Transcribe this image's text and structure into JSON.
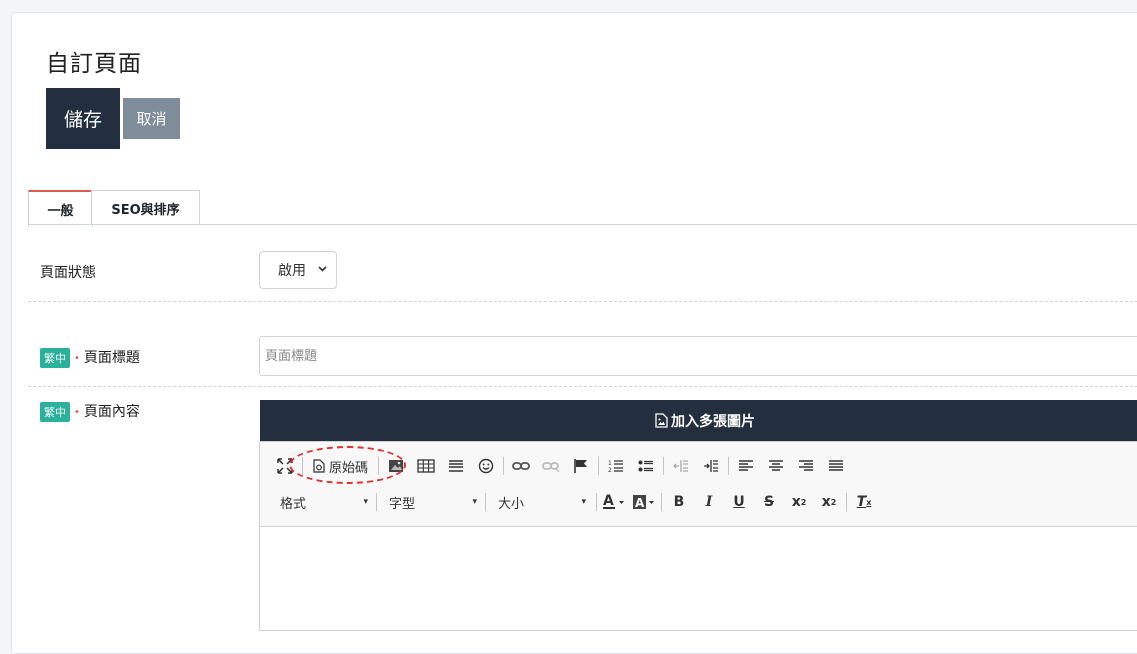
{
  "page": {
    "title": "自訂頁面"
  },
  "actions": {
    "save_label": "儲存",
    "cancel_label": "取消"
  },
  "tabs": [
    {
      "label": "一般",
      "active": true
    },
    {
      "label": "SEO與排序",
      "active": false
    }
  ],
  "status_row": {
    "label": "頁面狀態",
    "select_value": "啟用"
  },
  "title_row": {
    "lang_badge": "繁中",
    "label": "頁面標題",
    "placeholder": "頁面標題"
  },
  "content_row": {
    "lang_badge": "繁中",
    "label": "頁面內容"
  },
  "editor": {
    "multi_image_label": "加入多張圖片",
    "source_label": "原始碼",
    "format_label": "格式",
    "font_label": "字型",
    "size_label": "大小"
  },
  "colors": {
    "dark": "#232f3e",
    "cancel": "#7f8c99",
    "badge": "#2ab19b",
    "accent": "#e05a4f"
  }
}
